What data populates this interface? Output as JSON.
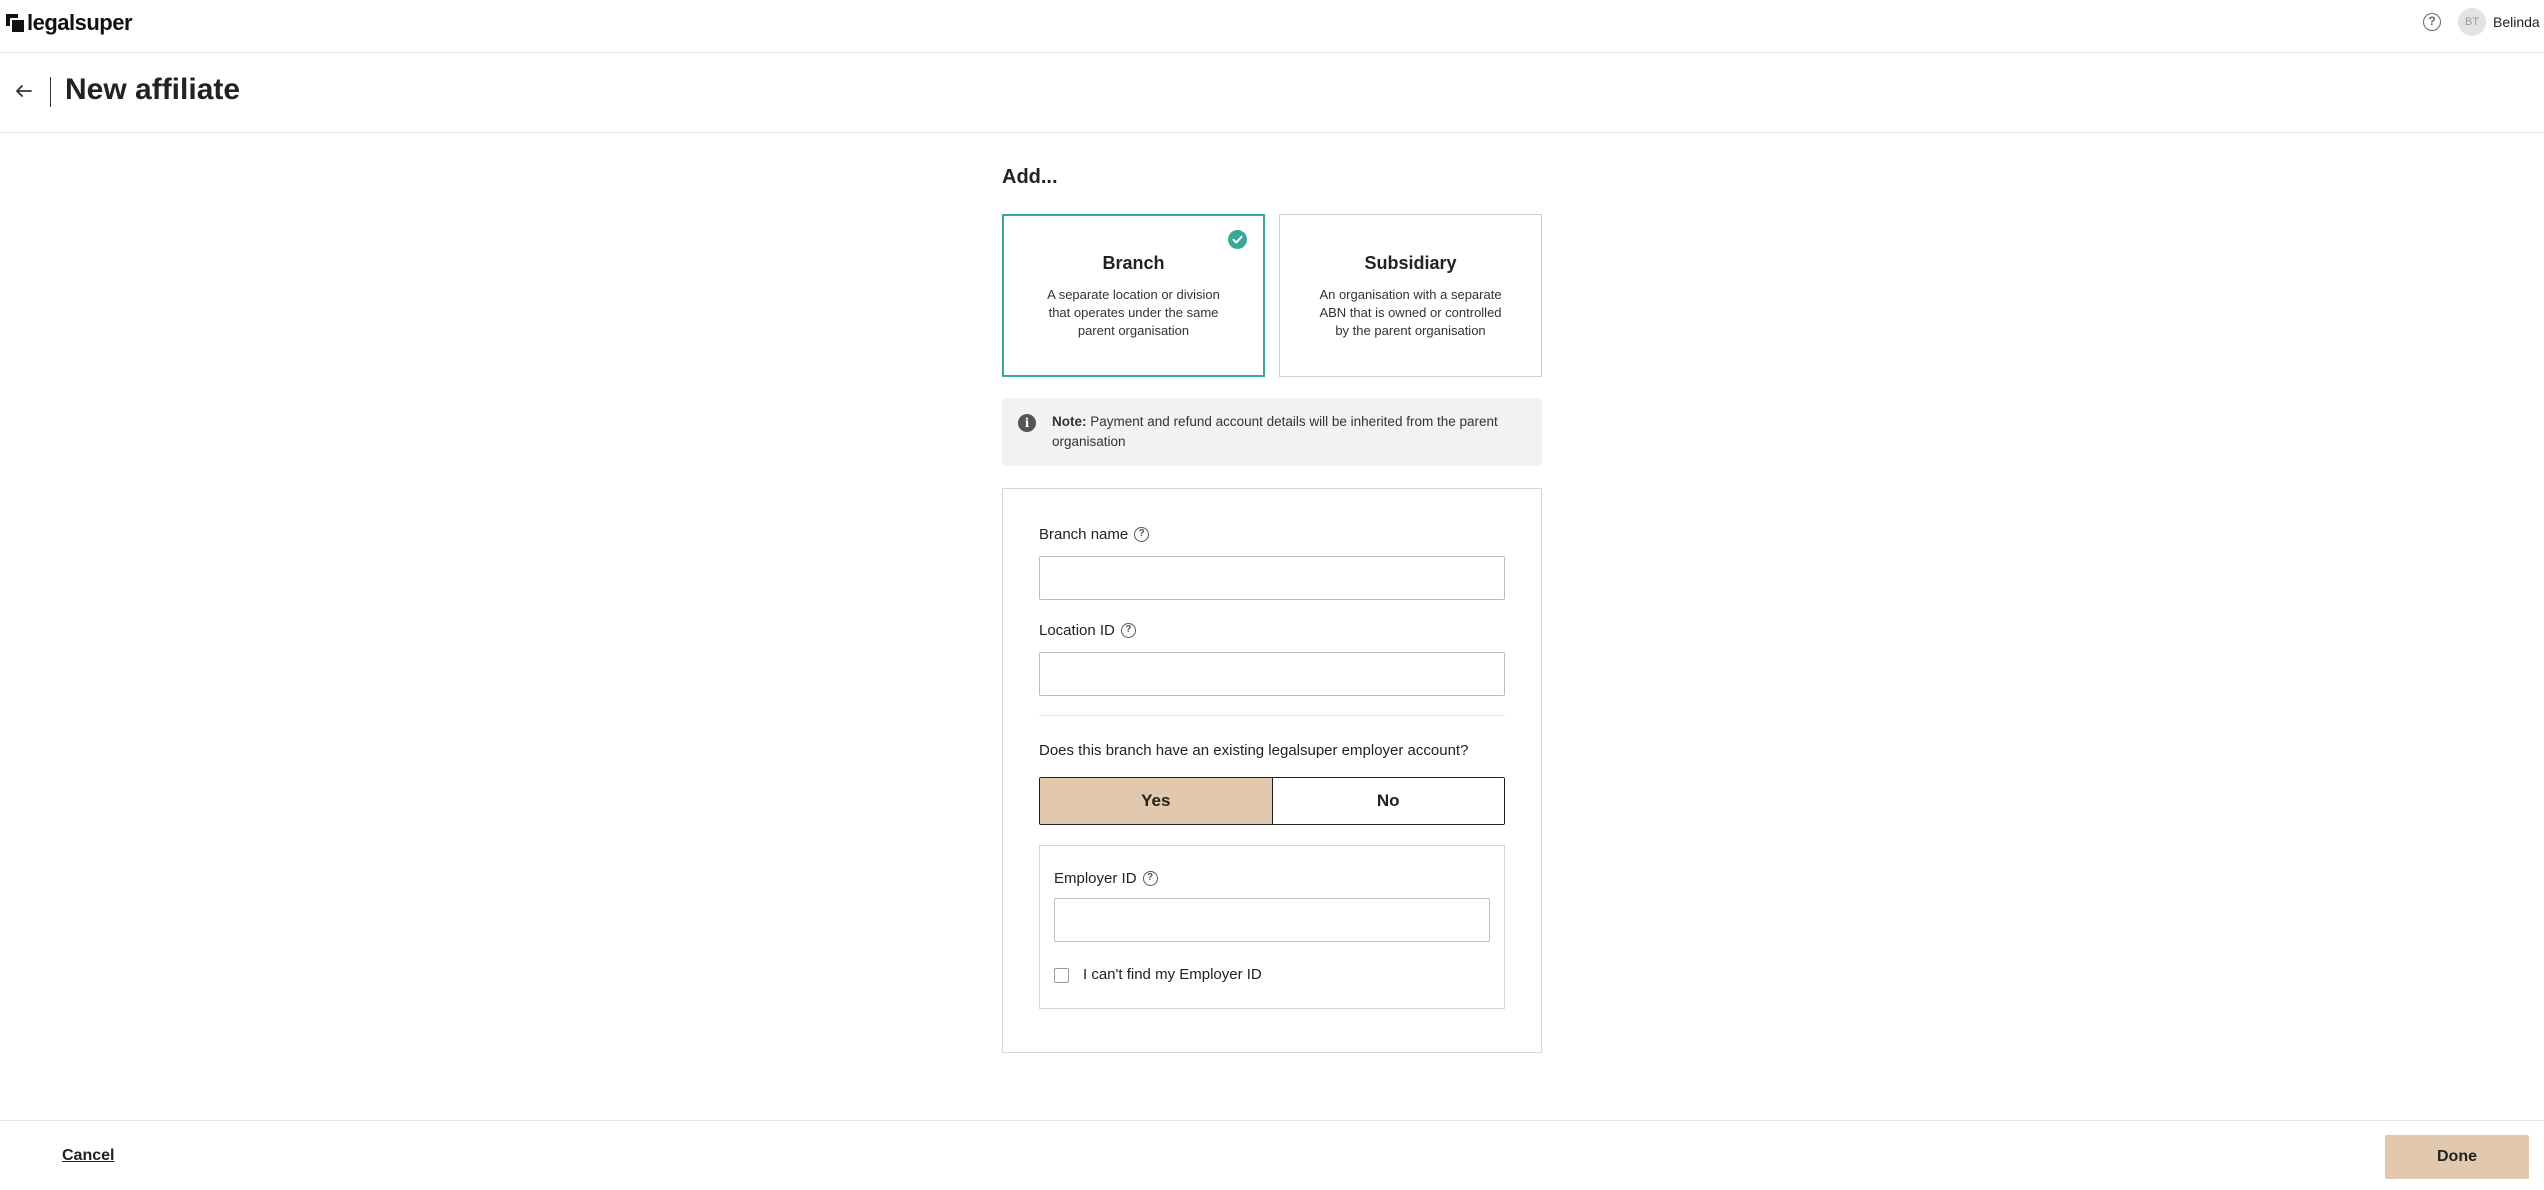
{
  "app": {
    "logo_text": "legalsuper"
  },
  "header": {
    "help_icon": "help-circle-icon",
    "user_initials": "BT",
    "user_name": "Belinda"
  },
  "page": {
    "title": "New affiliate",
    "back_icon": "arrow-left-icon"
  },
  "add_section": {
    "title": "Add...",
    "options": [
      {
        "title": "Branch",
        "description": "A separate location or division that operates under the same parent organisation",
        "selected": true
      },
      {
        "title": "Subsidiary",
        "description": "An organisation with a separate ABN that is owned or controlled by the parent organisation",
        "selected": false
      }
    ]
  },
  "note": {
    "prefix": "Note:",
    "text": "Payment and refund account details will be inherited from the parent organisation"
  },
  "form": {
    "branch_name": {
      "label": "Branch name",
      "value": ""
    },
    "location_id": {
      "label": "Location ID",
      "value": ""
    },
    "existing_account_question": "Does this branch have an existing legalsuper employer account?",
    "toggle": {
      "yes": "Yes",
      "no": "No",
      "selected": "Yes"
    },
    "employer_id": {
      "label": "Employer ID",
      "value": ""
    },
    "cant_find_label": "I can't find my Employer ID",
    "cant_find_checked": false
  },
  "footer": {
    "cancel_label": "Cancel",
    "done_label": "Done"
  },
  "colors": {
    "accent_teal": "#3aa79a",
    "button_tan": "#e2c9ad"
  }
}
